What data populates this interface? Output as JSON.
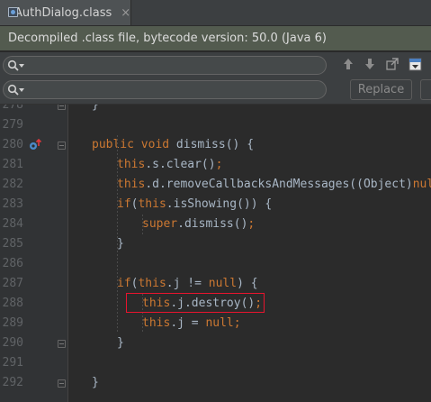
{
  "tab": {
    "title": "AuthDialog.class",
    "close": "×",
    "icon": "class-file-icon"
  },
  "banner": {
    "text": "Decompiled .class file, bytecode version: 50.0 (Java 6)"
  },
  "search": {
    "find_value": "",
    "replace_value": "",
    "replace_label": "Replace",
    "tools": [
      "arrow-up-icon",
      "arrow-down-icon",
      "export-icon",
      "filter-icon"
    ]
  },
  "editor": {
    "line_numbers": [
      "278",
      "279",
      "280",
      "281",
      "282",
      "283",
      "284",
      "285",
      "286",
      "287",
      "288",
      "289",
      "290",
      "291",
      "292"
    ],
    "lines": [
      [
        [
          "p",
          "}"
        ]
      ],
      [],
      [
        [
          "kw",
          "public void "
        ],
        [
          "p",
          "dismiss() {"
        ]
      ],
      [
        [
          "kw",
          "this"
        ],
        [
          "p",
          ".s.clear()"
        ],
        [
          "kw",
          ";"
        ]
      ],
      [
        [
          "kw",
          "this"
        ],
        [
          "p",
          ".d.removeCallbacksAndMessages((Object)"
        ],
        [
          "kw",
          "null"
        ],
        [
          "p",
          ")"
        ],
        [
          "kw",
          ";"
        ]
      ],
      [
        [
          "kw",
          "if"
        ],
        [
          "p",
          "("
        ],
        [
          "kw",
          "this"
        ],
        [
          "p",
          ".isShowing()) {"
        ]
      ],
      [
        [
          "kw",
          "super"
        ],
        [
          "p",
          ".dismiss()"
        ],
        [
          "kw",
          ";"
        ]
      ],
      [
        [
          "p",
          "}"
        ]
      ],
      [],
      [
        [
          "kw",
          "if"
        ],
        [
          "p",
          "("
        ],
        [
          "kw",
          "this"
        ],
        [
          "p",
          ".j != "
        ],
        [
          "kw",
          "null"
        ],
        [
          "p",
          ") {"
        ]
      ],
      [
        [
          "kw",
          "this"
        ],
        [
          "p",
          ".j.destroy()"
        ],
        [
          "kw",
          ";"
        ]
      ],
      [
        [
          "kw",
          "this"
        ],
        [
          "p",
          ".j = "
        ],
        [
          "kw",
          "null"
        ],
        [
          "kw",
          ";"
        ]
      ],
      [
        [
          "p",
          "}"
        ]
      ],
      [],
      [
        [
          "p",
          "}"
        ]
      ]
    ],
    "colors": {
      "keyword": "#cc7832",
      "plain": "#a9b7c6",
      "highlight_box": "#e8142e"
    }
  }
}
